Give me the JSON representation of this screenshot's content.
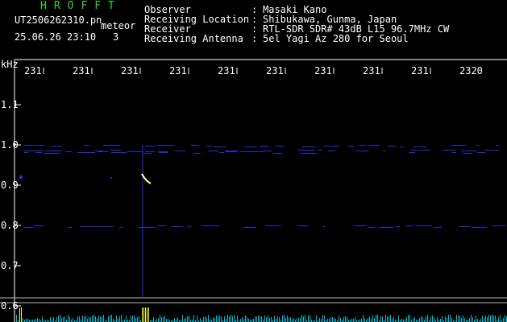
{
  "header": {
    "app_title": "HROFFT",
    "file_name": "UT2506262310.pn",
    "mode": "meteor",
    "datetime": "25.06.26 23:10",
    "count": "3",
    "info": [
      {
        "label": "Observer",
        "value": "Masaki Kano"
      },
      {
        "label": "Receiving Location",
        "value": "Shibukawa, Gunma, Japan"
      },
      {
        "label": "Receiver",
        "value": "RTL-SDR SDR# 43dB L15 96.7MHz CW"
      },
      {
        "label": "Receiving Antenna",
        "value": "5el Yagi Az 280 for Seoul"
      }
    ]
  },
  "chart_data": {
    "type": "heatmap",
    "ylabel": "kHz",
    "y_ticks": [
      "1.1",
      "1.0",
      "0.9",
      "0.8",
      "0.7",
      "0.6"
    ],
    "x_ticks": [
      "231",
      "231",
      "231",
      "231",
      "231",
      "231",
      "231",
      "231",
      "231",
      "2320"
    ],
    "ylim": [
      0.6,
      1.1
    ]
  },
  "colors": {
    "title": "#2ed62e",
    "text": "#ffffff",
    "trace": "#2a2ad8",
    "echo": "#ffff00",
    "strip": "#00bcd4"
  }
}
